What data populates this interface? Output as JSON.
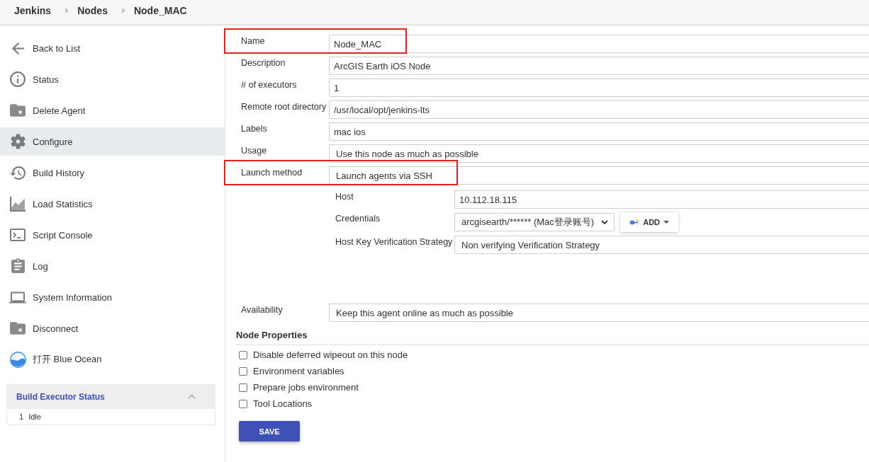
{
  "breadcrumbs": [
    "Jenkins",
    "Nodes",
    "Node_MAC"
  ],
  "sidebar": {
    "items": [
      {
        "label": "Back to List",
        "selected": false
      },
      {
        "label": "Status",
        "selected": false
      },
      {
        "label": "Delete Agent",
        "selected": false
      },
      {
        "label": "Configure",
        "selected": true
      },
      {
        "label": "Build History",
        "selected": false
      },
      {
        "label": "Load Statistics",
        "selected": false
      },
      {
        "label": "Script Console",
        "selected": false
      },
      {
        "label": "Log",
        "selected": false
      },
      {
        "label": "System Information",
        "selected": false
      },
      {
        "label": "Disconnect",
        "selected": false
      },
      {
        "label": "打开 Blue Ocean",
        "selected": false
      }
    ],
    "executor_panel": {
      "title": "Build Executor Status",
      "expanded": true,
      "executors": [
        {
          "number": "1",
          "status": "Idle"
        }
      ]
    }
  },
  "form": {
    "fields": [
      {
        "label": "Name",
        "kind": "text",
        "value": "Node_MAC",
        "highlighted": true
      },
      {
        "label": "Description",
        "kind": "text",
        "value": "ArcGIS Earth iOS Node",
        "highlighted": false
      },
      {
        "label": "# of executors",
        "kind": "text",
        "value": "1",
        "highlighted": false
      },
      {
        "label": "Remote root directory",
        "kind": "text",
        "value": "/usr/local/opt/jenkins-lts",
        "highlighted": false
      },
      {
        "label": "Labels",
        "kind": "text",
        "value": "mac ios",
        "highlighted": false
      },
      {
        "label": "Usage",
        "kind": "select",
        "value": "Use this node as much as possible",
        "highlighted": false
      },
      {
        "label": "Launch method",
        "kind": "select",
        "value": "Launch agents via SSH",
        "highlighted": true,
        "children": [
          {
            "label": "Host",
            "kind": "text",
            "value": "10.112.18.115",
            "highlighted": false
          },
          {
            "label": "Credentials",
            "kind": "credentials",
            "value": "arcgisearth/****** (Mac登录账号)",
            "add_button": "ADD",
            "highlighted": false
          },
          {
            "label": "Host Key Verification Strategy",
            "kind": "select",
            "value": "Non verifying Verification Strategy",
            "highlighted": false
          }
        ]
      },
      {
        "label": "Availability",
        "kind": "select",
        "value": "Keep this agent online as much as possible",
        "highlighted": false
      }
    ],
    "node_properties": {
      "title": "Node Properties",
      "options": [
        {
          "label": "Disable deferred wipeout on this node",
          "checked": false
        },
        {
          "label": "Environment variables",
          "checked": false
        },
        {
          "label": "Prepare jobs environment",
          "checked": false
        },
        {
          "label": "Tool Locations",
          "checked": false
        }
      ]
    },
    "save_button": "SAVE"
  }
}
